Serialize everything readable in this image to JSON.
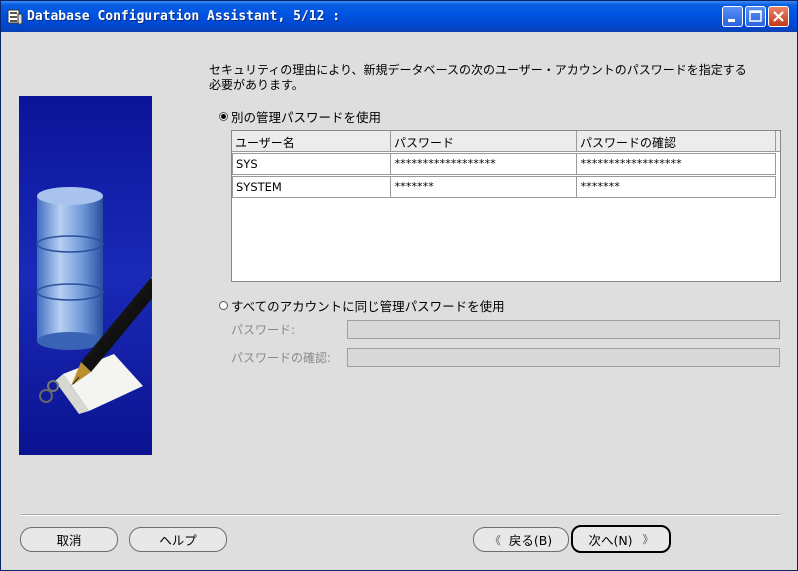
{
  "window": {
    "title": "Database Configuration Assistant, 5/12 :"
  },
  "instruction": "セキュリティの理由により、新規データベースの次のユーザー・アカウントのパスワードを指定する\n必要があります。",
  "option_separate": {
    "label": "別の管理パスワードを使用",
    "checked": true
  },
  "accounts_table": {
    "columns": [
      "ユーザー名",
      "パスワード",
      "パスワードの確認"
    ],
    "rows": [
      {
        "user": "SYS",
        "password": "******************",
        "confirm": "******************"
      },
      {
        "user": "SYSTEM",
        "password": "*******",
        "confirm": "*******"
      }
    ]
  },
  "option_same": {
    "label": "すべてのアカウントに同じ管理パスワードを使用",
    "checked": false
  },
  "same_password": {
    "password_label": "パスワード:",
    "confirm_label": "パスワードの確認:"
  },
  "buttons": {
    "cancel": "取消",
    "help": "ヘルプ",
    "back": "戻る(B)",
    "next": "次へ(N)"
  }
}
